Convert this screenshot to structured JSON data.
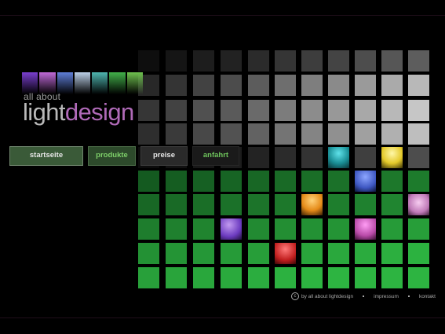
{
  "logo": {
    "tagline": "all about",
    "word_light": "light",
    "word_design": "design",
    "strip_colors": [
      "#7b3fd0",
      "#c06ad8",
      "#5f7fd8",
      "#bcd0e8",
      "#4fb6b0",
      "#42b04a",
      "#6fc24f"
    ]
  },
  "nav": {
    "items": [
      {
        "label": "startseite",
        "color": "#e6e6e6",
        "bg": "#3a5a38",
        "border": "#70866e"
      },
      {
        "label": "produkte",
        "color": "#7ed06a",
        "bg": "#2d4a2b",
        "border": "#4b6b47"
      },
      {
        "label": "preise",
        "color": "#e6e6e6",
        "bg": "#2a2a2a",
        "border": "#3b3b3b"
      },
      {
        "label": "anfahrt",
        "color": "#6ec45c",
        "bg": "#1a1a1a",
        "border": "#262626"
      }
    ]
  },
  "footer": {
    "copyright_symbol": "c",
    "copyright_text": "by all about lightdesign",
    "impressum": "impressum",
    "kontakt": "kontakt"
  },
  "colors": {
    "background": "#000000",
    "accent_purple": "#b06ab8",
    "accent_green": "#7ed06a"
  }
}
